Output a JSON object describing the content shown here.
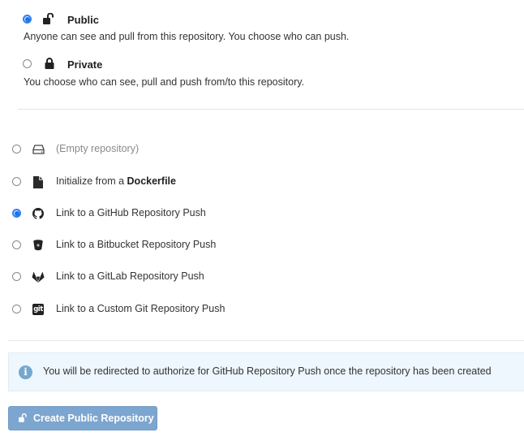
{
  "visibility": {
    "options": [
      {
        "id": "public",
        "title": "Public",
        "description": "Anyone can see and pull from this repository. You choose who can push.",
        "icon": "unlock-icon",
        "selected": true
      },
      {
        "id": "private",
        "title": "Private",
        "description": "You choose who can see, pull and push from/to this repository.",
        "icon": "lock-icon",
        "selected": false
      }
    ]
  },
  "initialize": {
    "options": [
      {
        "id": "empty",
        "label": "(Empty repository)",
        "icon": "hard-drive-icon",
        "selected": false
      },
      {
        "id": "dockerfile",
        "label_prefix": "Initialize from a ",
        "label_bold": "Dockerfile",
        "icon": "file-icon",
        "selected": false
      },
      {
        "id": "github",
        "label": "Link to a GitHub Repository Push",
        "icon": "github-icon",
        "selected": true
      },
      {
        "id": "bitbucket",
        "label": "Link to a Bitbucket Repository Push",
        "icon": "bitbucket-icon",
        "selected": false
      },
      {
        "id": "gitlab",
        "label": "Link to a GitLab Repository Push",
        "icon": "gitlab-icon",
        "selected": false
      },
      {
        "id": "custom-git",
        "label": "Link to a Custom Git Repository Push",
        "icon": "git-icon",
        "selected": false
      }
    ]
  },
  "info": {
    "icon": "info-icon",
    "glyph": "i",
    "text": "You will be redirected to authorize for GitHub Repository Push once the repository has been created"
  },
  "create_button": {
    "label": "Create Public Repository",
    "icon": "unlock-icon"
  },
  "colors": {
    "accent": "#1a73e8",
    "button_bg": "#7ca6cf",
    "info_bg": "#edf7fd",
    "info_icon": "#74a8cc"
  },
  "git_icon_text": "git"
}
